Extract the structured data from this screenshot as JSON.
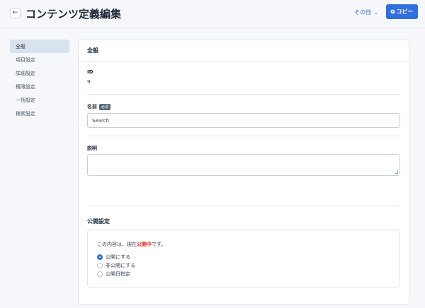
{
  "header": {
    "back_icon": "arrow-left-icon",
    "title": "コンテンツ定義編集",
    "more_label": "その他",
    "copy_label": "コピー"
  },
  "sidebar": {
    "items": [
      {
        "label": "全般",
        "active": true
      },
      {
        "label": "項目設定",
        "active": false
      },
      {
        "label": "詳細設定",
        "active": false
      },
      {
        "label": "権限設定",
        "active": false
      },
      {
        "label": "一括設定",
        "active": false
      },
      {
        "label": "検索設定",
        "active": false
      }
    ]
  },
  "general": {
    "heading": "全般",
    "id_label": "ID",
    "id_value": "9",
    "name_label": "名前",
    "required_badge": "必須",
    "name_value": "Search",
    "description_label": "説明",
    "description_value": ""
  },
  "publish": {
    "heading": "公開設定",
    "status_prefix": "この内容は、現在",
    "status_word": "公開中",
    "status_suffix": "です。",
    "options": [
      {
        "label": "公開にする",
        "checked": true
      },
      {
        "label": "非公開にする",
        "checked": false
      },
      {
        "label": "公開日指定",
        "checked": false
      }
    ]
  },
  "colors": {
    "accent": "#2f6fdf",
    "status_public": "#e02424"
  }
}
